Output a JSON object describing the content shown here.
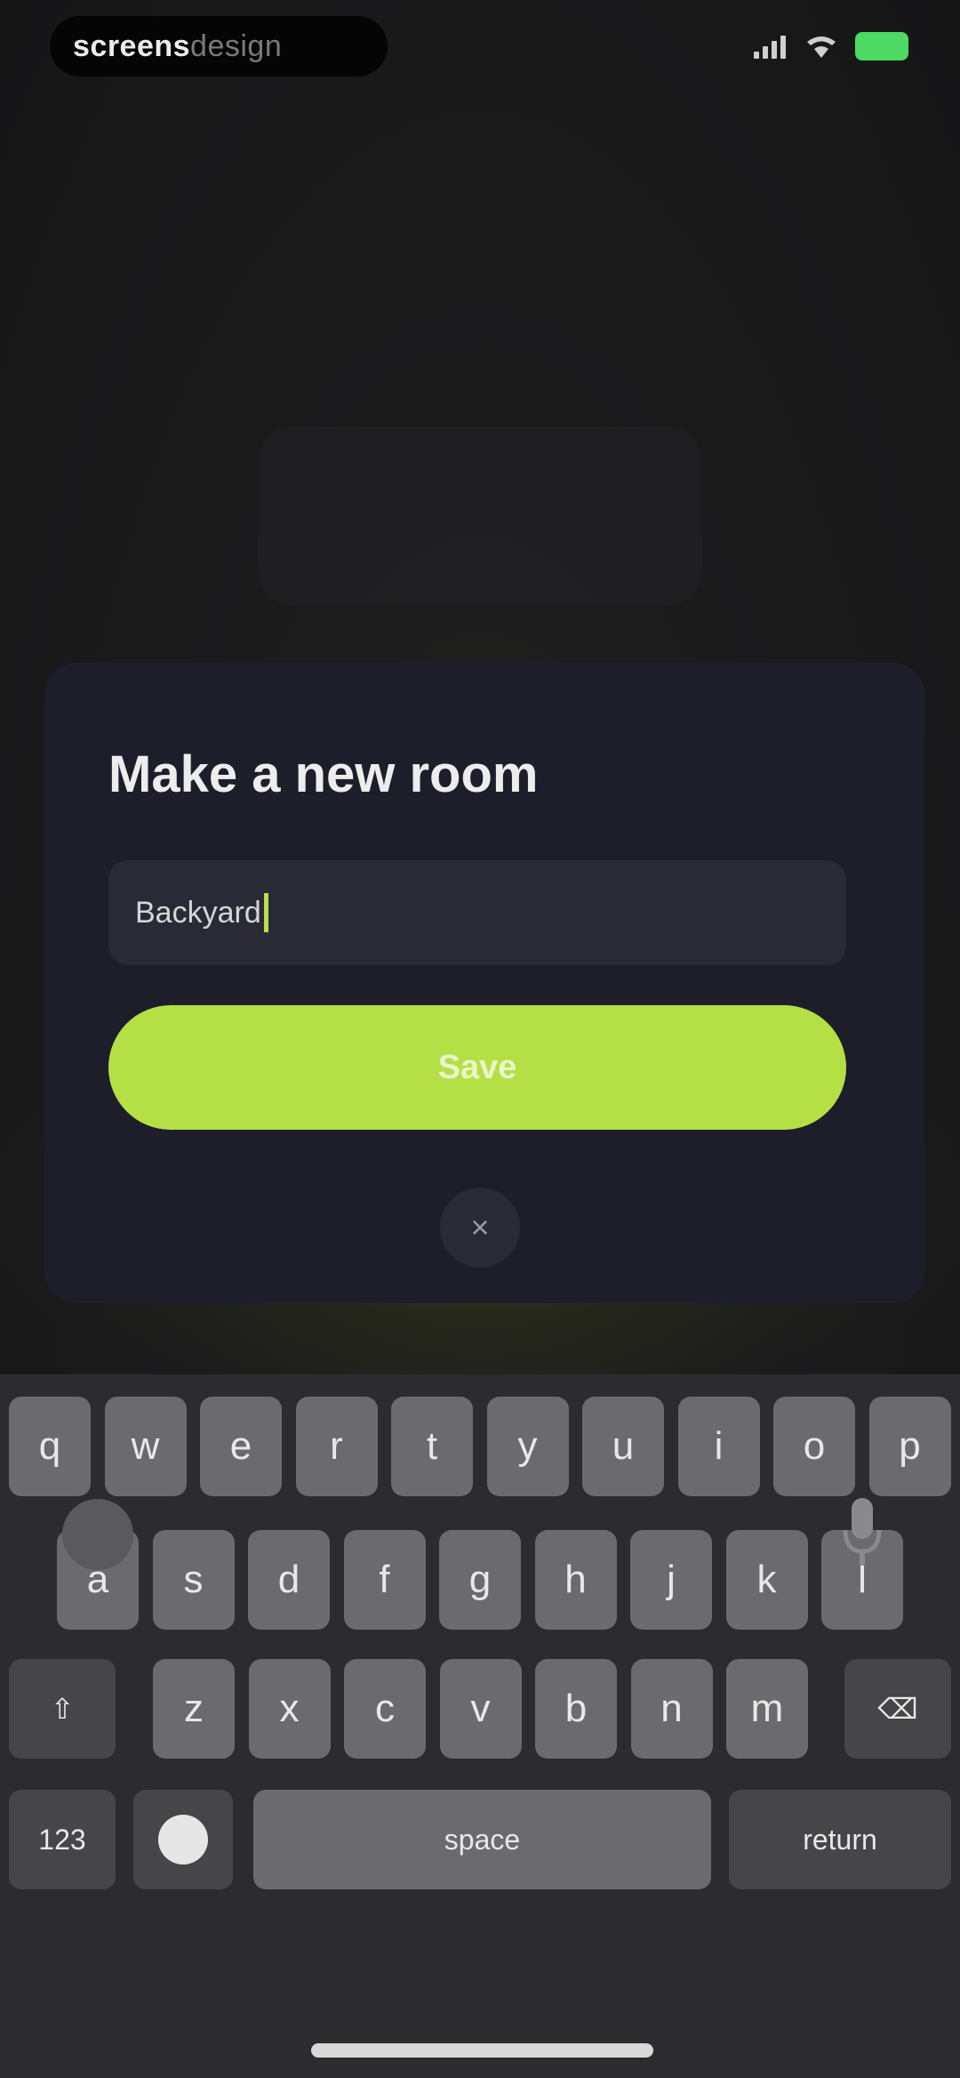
{
  "status_bar": {
    "brand_bold": "screens",
    "brand_light": "design",
    "icons": [
      "signal-icon",
      "wifi-icon",
      "battery-icon"
    ],
    "battery_color": "#4cd964"
  },
  "modal": {
    "title": "Make a new room",
    "input_value": "Backyard",
    "save_label": "Save",
    "close_symbol": "×"
  },
  "colors": {
    "accent": "#b4e046",
    "modal_bg": "#1e1e2b",
    "input_bg": "#2a2a37"
  },
  "keyboard": {
    "row1": [
      "q",
      "w",
      "e",
      "r",
      "t",
      "y",
      "u",
      "i",
      "o",
      "p"
    ],
    "row2": [
      "a",
      "s",
      "d",
      "f",
      "g",
      "h",
      "j",
      "k",
      "l"
    ],
    "row3": [
      "z",
      "x",
      "c",
      "v",
      "b",
      "n",
      "m"
    ],
    "shift_symbol": "⇧",
    "delete_symbol": "⌫",
    "numbers_label": "123",
    "space_label": "space",
    "return_label": "return"
  }
}
